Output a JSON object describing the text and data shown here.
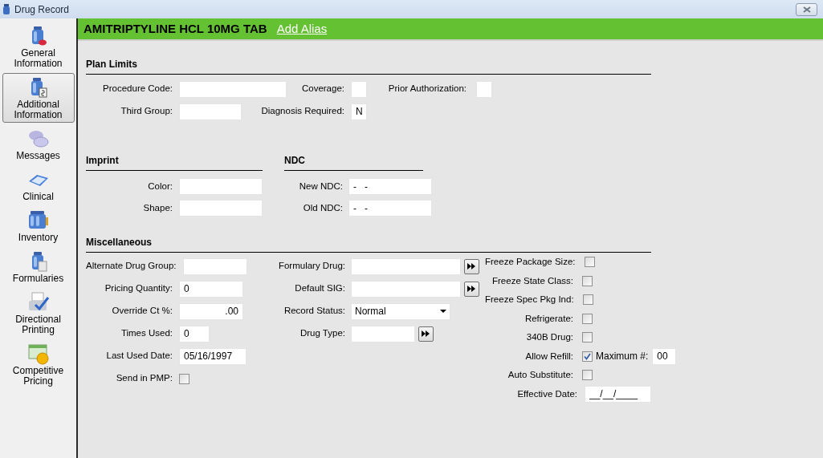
{
  "window": {
    "title": "Drug Record"
  },
  "sidebar": {
    "items": [
      {
        "label": "General Information",
        "selected": false
      },
      {
        "label": "Additional Information",
        "selected": true
      },
      {
        "label": "Messages",
        "selected": false
      },
      {
        "label": "Clinical",
        "selected": false
      },
      {
        "label": "Inventory",
        "selected": false
      },
      {
        "label": "Formularies",
        "selected": false
      },
      {
        "label": "Directional Printing",
        "selected": false
      },
      {
        "label": "Competitive Pricing",
        "selected": false
      }
    ]
  },
  "header": {
    "drug_name": "AMITRIPTYLINE HCL 10MG TAB",
    "link": "Add Alias"
  },
  "plan_limits": {
    "title": "Plan Limits",
    "rows": [
      [
        {
          "label": "Procedure Code:"
        },
        {
          "label": "Coverage:"
        },
        {
          "label": "Prior Authorization:"
        }
      ],
      [
        {
          "label": "Third Group:"
        },
        {
          "label": "Diagnosis Required:",
          "value": "N"
        }
      ]
    ]
  },
  "imprint": {
    "title": "Imprint",
    "fields": [
      {
        "label": "Color:"
      },
      {
        "label": "Shape:"
      }
    ]
  },
  "ndc": {
    "title": "NDC",
    "fields": [
      {
        "label": "New NDC:",
        "value": "-   -"
      },
      {
        "label": "Old NDC:",
        "value": "-   -"
      }
    ]
  },
  "miscellaneous": {
    "title": "Miscellaneous",
    "columns": [
      [
        {
          "kind": "text",
          "label": "Alternate Drug Group:"
        },
        {
          "kind": "text",
          "label": "Pricing Quantity:",
          "value": "0"
        },
        {
          "kind": "number",
          "label": "Override Ct %:",
          "value": ".00"
        },
        {
          "kind": "text",
          "label": "Times Used:",
          "value": "0"
        },
        {
          "kind": "text",
          "label": "Last Used Date:",
          "value": "05/16/1997"
        },
        {
          "kind": "checkbox",
          "label": "Send in PMP:",
          "checked": false
        }
      ],
      [
        {
          "kind": "lookup",
          "label": "Formulary Drug:"
        },
        {
          "kind": "lookup",
          "label": "Default SIG:"
        },
        {
          "kind": "dropdown",
          "label": "Record Status:",
          "value": "Normal"
        },
        {
          "kind": "lookup",
          "label": "Drug Type:"
        }
      ],
      [
        {
          "kind": "checkbox",
          "label": "Freeze Package Size:",
          "checked": false
        },
        {
          "kind": "checkbox",
          "label": "Freeze State Class:",
          "checked": false
        },
        {
          "kind": "checkbox",
          "label": "Freeze Spec Pkg Ind:",
          "checked": false
        },
        {
          "kind": "checkbox",
          "label": "Refrigerate:",
          "checked": false
        },
        {
          "kind": "checkbox",
          "label": "340B Drug:",
          "checked": false
        },
        {
          "kind": "checkbox",
          "label": "Allow Refill:",
          "checked": true,
          "extra_label": "Maximum #:",
          "extra_value": "00"
        },
        {
          "kind": "checkbox",
          "label": "Auto Substitute:",
          "checked": false
        },
        {
          "kind": "text",
          "label": "Effective Date:",
          "value": "__/__/____"
        }
      ]
    ]
  }
}
